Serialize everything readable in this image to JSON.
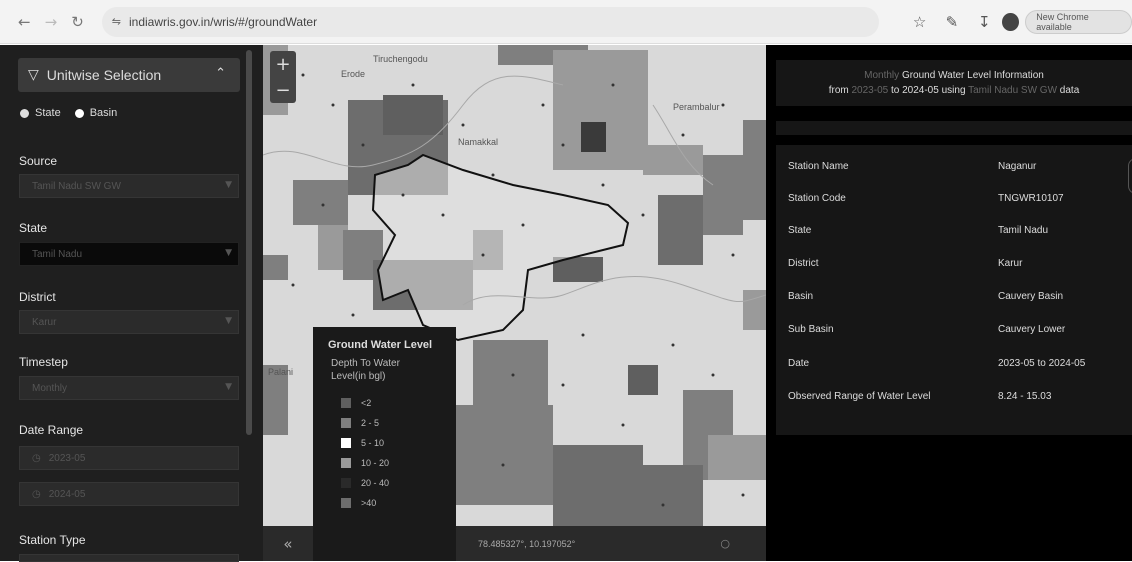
{
  "browser": {
    "url": "indiawris.gov.in/wris/#/groundWater",
    "update_label": "New Chrome available"
  },
  "left_panel": {
    "section_title": "Unitwise Selection",
    "radio_state": "State",
    "radio_basin": "Basin",
    "source_label": "Source",
    "source_value": "Tamil Nadu SW GW",
    "state_label": "State",
    "state_value": "Tamil Nadu",
    "district_label": "District",
    "district_value": "Karur",
    "timestep_label": "Timestep",
    "timestep_value": "Monthly",
    "date_range_label": "Date Range",
    "date_from": "2023-05",
    "date_to": "2024-05",
    "station_type_label": "Station Type"
  },
  "map": {
    "places": [
      "Erode",
      "Tiruchengodu",
      "Namakkal",
      "Perambalur",
      "Palani"
    ],
    "legend": {
      "title": "Ground Water Level",
      "subtitle": "Depth To Water Level(in bgl)",
      "items": [
        {
          "label": "<2",
          "color": "#5f5f5f"
        },
        {
          "label": "2 - 5",
          "color": "#7f7f7f"
        },
        {
          "label": "5 - 10",
          "color": "#ffffff"
        },
        {
          "label": "10 - 20",
          "color": "#9a9a9a"
        },
        {
          "label": "20 - 40",
          "color": "#2a2a2a"
        },
        {
          "label": ">40",
          "color": "#6d6d6d"
        }
      ]
    },
    "coordinates": "78.485327°, 10.197052°"
  },
  "info": {
    "title_line1_dim": "Monthly",
    "title_line1": "Ground Water Level Information",
    "title_line2_a": "from",
    "title_line2_b": "2023-05",
    "title_line2_c": "to",
    "title_line2_d": "2024-05",
    "title_line2_e": "using",
    "title_line2_f": "Tamil Nadu SW GW",
    "title_line2_g": "data",
    "rows": [
      {
        "key": "Station Name",
        "value": "Naganur"
      },
      {
        "key": "Station Code",
        "value": "TNGWR10107"
      },
      {
        "key": "State",
        "value": "Tamil Nadu"
      },
      {
        "key": "District",
        "value": "Karur"
      },
      {
        "key": "Basin",
        "value": "Cauvery Basin"
      },
      {
        "key": "Sub Basin",
        "value": "Cauvery Lower"
      },
      {
        "key": "Date",
        "value": "2023-05 to 2024-05"
      },
      {
        "key": "Observed Range of Water Level",
        "value": "8.24 - 15.03"
      }
    ]
  }
}
